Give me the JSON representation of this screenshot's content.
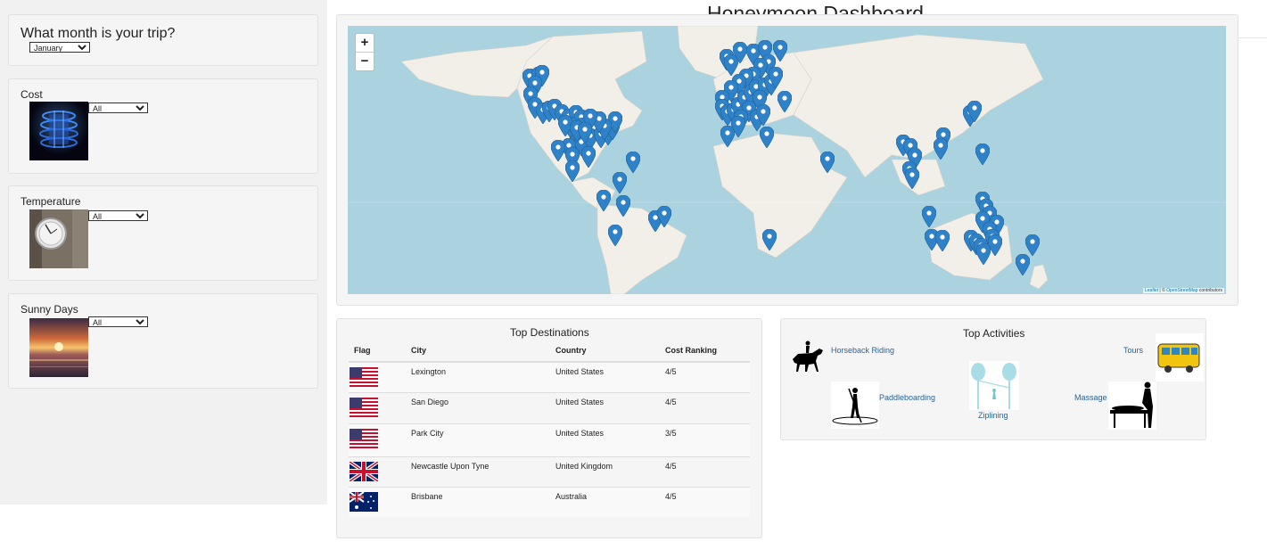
{
  "header": {
    "title": "Honeymoon Dashboard"
  },
  "sidebar": {
    "month": {
      "label": "What month is your trip?",
      "value": "January"
    },
    "filters": [
      {
        "label": "Cost",
        "value": "All"
      },
      {
        "label": "Temperature",
        "value": "All"
      },
      {
        "label": "Sunny Days",
        "value": "All"
      }
    ]
  },
  "map": {
    "zoom_in": "+",
    "zoom_out": "−",
    "attribution_leaflet": "Leaflet",
    "attribution_sep": " | © ",
    "attribution_osm": "OpenStreetMap",
    "attribution_tail": " contributors",
    "marker_color": "#2f82c8",
    "land_color": "#f2efe9",
    "water_color": "#aad3df"
  },
  "destinations": {
    "title": "Top Destinations",
    "columns": [
      "Flag",
      "City",
      "Country",
      "Cost Ranking"
    ],
    "rows": [
      {
        "flag": "us-flag",
        "city": "Lexington",
        "country": "United States",
        "cost": "4/5"
      },
      {
        "flag": "us-flag",
        "city": "San Diego",
        "country": "United States",
        "cost": "4/5"
      },
      {
        "flag": "us-flag",
        "city": "Park City",
        "country": "United States",
        "cost": "3/5"
      },
      {
        "flag": "uk-flag",
        "city": "Newcastle Upon Tyne",
        "country": "United Kingdom",
        "cost": "4/5"
      },
      {
        "flag": "au-flag",
        "city": "Brisbane",
        "country": "Australia",
        "cost": "4/5"
      }
    ]
  },
  "activities": {
    "title": "Top Activities",
    "items": [
      {
        "label": "Horseback Riding",
        "icon": "horse-rider-icon"
      },
      {
        "label": "Tours",
        "icon": "tour-bus-icon"
      },
      {
        "label": "Paddleboarding",
        "icon": "paddleboard-icon"
      },
      {
        "label": "Ziplining",
        "icon": "zipline-icon"
      },
      {
        "label": "Massage",
        "icon": "massage-icon"
      }
    ]
  }
}
